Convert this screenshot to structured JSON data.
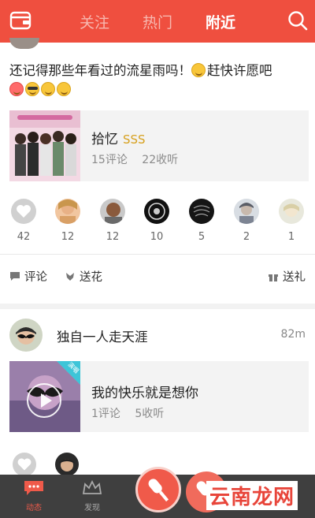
{
  "header": {
    "tabs": [
      {
        "label": "关注",
        "active": false
      },
      {
        "label": "热门",
        "active": false
      },
      {
        "label": "附近",
        "active": true
      }
    ],
    "accent_color": "#ef4f3f"
  },
  "post1": {
    "text": "还记得那些年看过的流星雨吗！",
    "text_tail": "赶快许愿吧",
    "media": {
      "title": "拾忆",
      "level": "SSS",
      "comments": "15评论",
      "listens": "22收听"
    },
    "fans": [
      {
        "count": "42",
        "icon": "heart-icon"
      },
      {
        "count": "12"
      },
      {
        "count": "12"
      },
      {
        "count": "10"
      },
      {
        "count": "5"
      },
      {
        "count": "2"
      },
      {
        "count": "1"
      }
    ],
    "actions": {
      "comment": "评论",
      "flower": "送花",
      "gift": "送礼"
    }
  },
  "post2": {
    "user_name": "独自一人走天涯",
    "time": "82m",
    "media": {
      "badge": "演唱",
      "title": "我的快乐就是想你",
      "comments": "1评论",
      "listens": "5收听"
    }
  },
  "bottom_nav": {
    "items": [
      {
        "label": "动态",
        "active": true
      },
      {
        "label": "发现",
        "active": false
      }
    ]
  },
  "watermark": "云南龙网"
}
